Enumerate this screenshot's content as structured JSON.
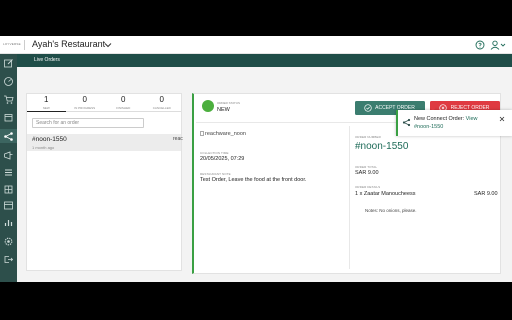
{
  "topbar": {
    "brand": "LOYVERSE",
    "restaurant_name": "Ayah's Restaurant"
  },
  "subbar": {
    "title": "Live Orders"
  },
  "tabs": [
    {
      "count": "1",
      "label": "NEW"
    },
    {
      "count": "0",
      "label": "IN PROGRESS"
    },
    {
      "count": "0",
      "label": "FINISHED"
    },
    {
      "count": "0",
      "label": "CANCELLED"
    }
  ],
  "search": {
    "placeholder": "Search for an order"
  },
  "order_list": [
    {
      "id": "#noon-1550",
      "age": "1 month ago",
      "logo_alt": "reachware_noon"
    }
  ],
  "order_status": {
    "label": "ORDER STATUS",
    "value": "NEW"
  },
  "buttons": {
    "accept": "ACCEPT ORDER",
    "reject": "REJECT ORDER"
  },
  "details": {
    "image_alt": "reachware_noon",
    "collection_time_label": "COLLECTION TIME",
    "collection_time": "20/05/2025, 07:29",
    "restaurant_note_label": "RESTAURANT NOTE",
    "restaurant_note": "Test Order, Leave the food at the front door.",
    "order_number_label": "ORDER NUMBER",
    "order_number": "#noon-1550",
    "order_total_label": "ORDER TOTAL",
    "order_total": "SAR 9.00",
    "order_details_label": "ORDER DETAILS",
    "line_item": "1 x Zaatar Manoucheess",
    "line_price": "SAR 9.00",
    "notes": "Notes: No onions, please."
  },
  "toast": {
    "prefix": "New Connect Order:",
    "link": "View",
    "order": "#noon-1550"
  },
  "colors": {
    "accent_green": "#3b7d6f",
    "reject_red": "#df3a41",
    "sidebar": "#2d4f4b",
    "status_green": "#4caf3e"
  }
}
